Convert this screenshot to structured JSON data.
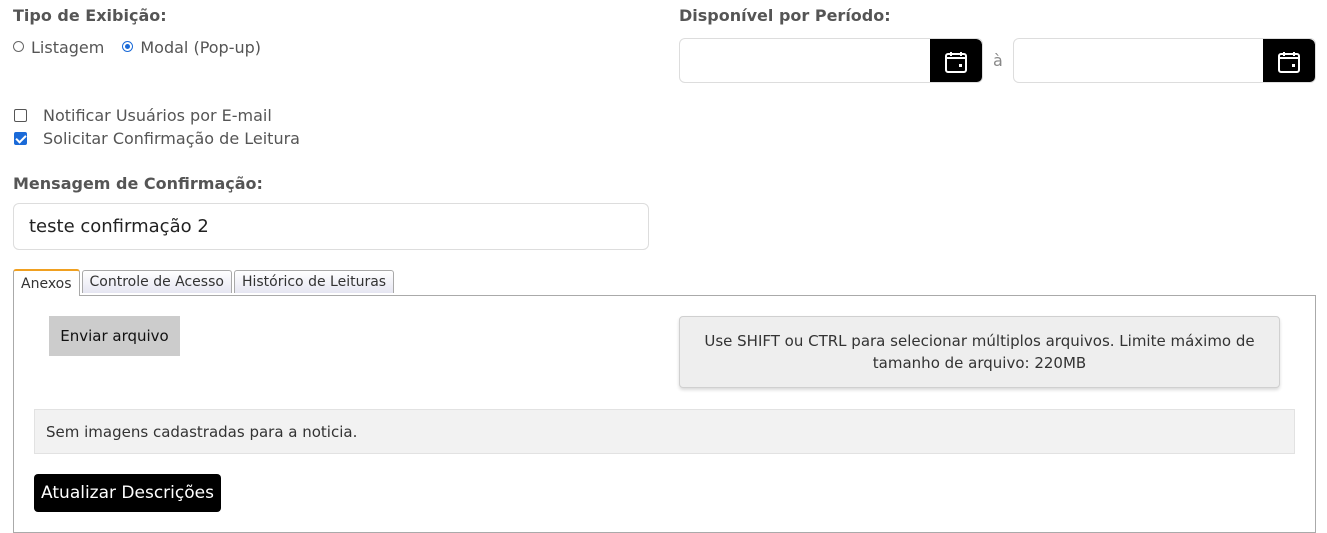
{
  "display_type": {
    "label": "Tipo de Exibição:",
    "options": [
      {
        "label": "Listagem",
        "selected": false
      },
      {
        "label": "Modal (Pop-up)",
        "selected": true
      }
    ]
  },
  "period": {
    "label": "Disponível por Período:",
    "separator": "à",
    "start_value": "",
    "end_value": "",
    "icon": "calendar-icon"
  },
  "checkboxes": [
    {
      "label": "Notificar Usuários por E-mail",
      "checked": false
    },
    {
      "label": "Solicitar Confirmação de Leitura",
      "checked": true
    }
  ],
  "confirmation": {
    "label": "Mensagem de Confirmação:",
    "value": "teste confirmação 2"
  },
  "tabs": [
    {
      "label": "Anexos",
      "active": true
    },
    {
      "label": "Controle de Acesso",
      "active": false
    },
    {
      "label": "Histórico de Leituras",
      "active": false
    }
  ],
  "attachments": {
    "upload_label": "Enviar arquivo",
    "info_text": "Use SHIFT ou CTRL para selecionar múltiplos arquivos. Limite máximo de tamanho de arquivo: 220MB",
    "empty_text": "Sem imagens cadastradas para a noticia.",
    "update_label": "Atualizar Descrições"
  },
  "colors": {
    "accent_blue": "#1a6ad8",
    "tab_active_border": "#f0a020",
    "button_dark": "#000000"
  }
}
